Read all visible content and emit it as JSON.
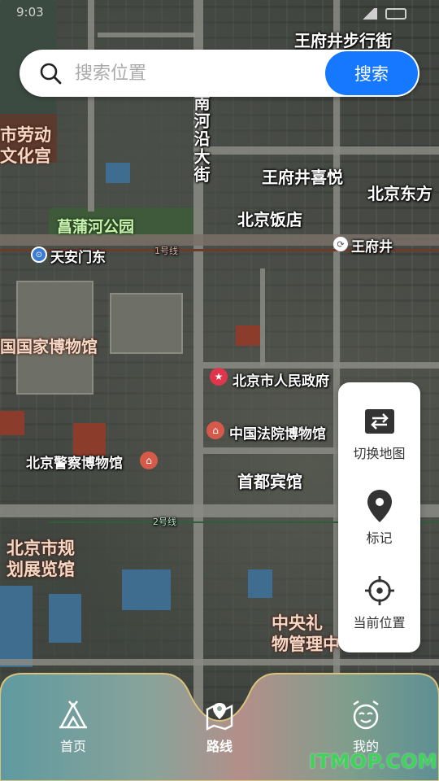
{
  "status_bar": {
    "time": "9:03"
  },
  "search": {
    "placeholder": "搜索位置",
    "value": "",
    "button_label": "搜索"
  },
  "map": {
    "labels": {
      "wangfujing_street": "王府井步行街",
      "laborer_palace_1": "市劳动",
      "laborer_palace_2": "文化宫",
      "nanheyan": "南河沿大街",
      "wangfujing_xiyue": "王府井喜悦",
      "beijing_dongfang": "北京东方",
      "changpu_park": "菖蒲河公园",
      "beijing_hotel": "北京饭店",
      "tiananmen_east": "天安门东",
      "line1": "1号线",
      "wangfujing": "王府井",
      "national_museum": "国国家博物馆",
      "municipal_gov": "北京市人民政府",
      "court_museum": "中国法院博物馆",
      "police_museum": "北京警察博物馆",
      "capital_hotel": "首都宾馆",
      "line2": "2号线",
      "planning_hall_1": "北京市规",
      "planning_hall_2": "划展览馆",
      "zhongyang_1": "中央礼",
      "zhongyang_2": "物管理中"
    }
  },
  "tools": [
    {
      "label": "切换地图",
      "icon": "switch-map-icon"
    },
    {
      "label": "标记",
      "icon": "location-pin-icon"
    },
    {
      "label": "当前位置",
      "icon": "crosshair-icon"
    }
  ],
  "nav": [
    {
      "label": "首页",
      "icon": "tent-icon",
      "active": false
    },
    {
      "label": "路线",
      "icon": "route-map-icon",
      "active": true
    },
    {
      "label": "我的",
      "icon": "smiley-alarm-icon",
      "active": false
    }
  ],
  "watermark": "ITMOP.COM",
  "colors": {
    "accent": "#1677ff",
    "nav_border": "#d9c27a",
    "watermark": "#3fd35a"
  }
}
